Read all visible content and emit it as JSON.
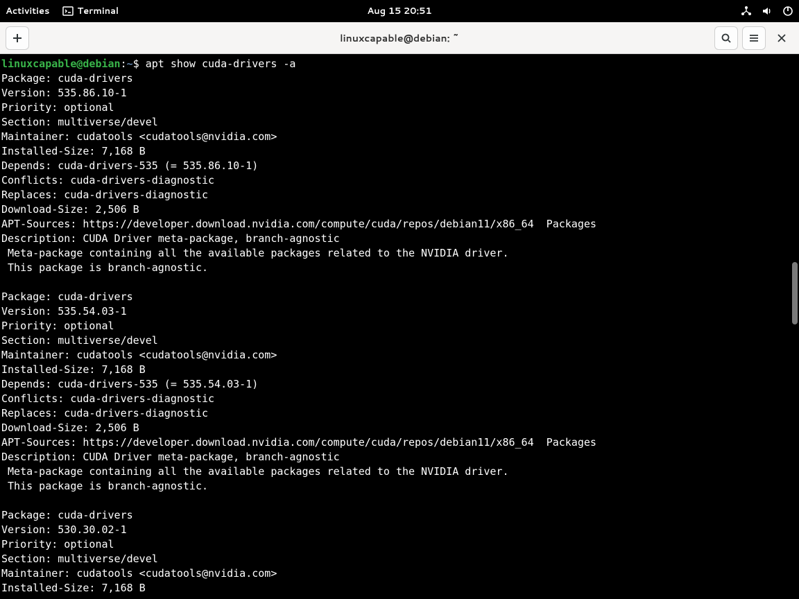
{
  "topbar": {
    "activities": "Activities",
    "app_name": "Terminal",
    "clock": "Aug 15  20:51"
  },
  "window": {
    "title": "linuxcapable@debian: ~"
  },
  "prompt": {
    "user_host": "linuxcapable@debian",
    "colon": ":",
    "cwd": "~",
    "dollar": "$",
    "command": " apt show cuda-drivers -a"
  },
  "packages": [
    {
      "Package": "Package: cuda-drivers",
      "Version": "Version: 535.86.10-1",
      "Priority": "Priority: optional",
      "Section": "Section: multiverse/devel",
      "Maintainer": "Maintainer: cudatools <cudatools@nvidia.com>",
      "Installed": "Installed-Size: 7,168 B",
      "Depends": "Depends: cuda-drivers-535 (= 535.86.10-1)",
      "Conflicts": "Conflicts: cuda-drivers-diagnostic",
      "Replaces": "Replaces: cuda-drivers-diagnostic",
      "Download": "Download-Size: 2,506 B",
      "Sources": "APT-Sources: https://developer.download.nvidia.com/compute/cuda/repos/debian11/x86_64  Packages",
      "Desc": "Description: CUDA Driver meta-package, branch-agnostic",
      "Desc2": " Meta-package containing all the available packages related to the NVIDIA driver.",
      "Desc3": " This package is branch-agnostic."
    },
    {
      "Package": "Package: cuda-drivers",
      "Version": "Version: 535.54.03-1",
      "Priority": "Priority: optional",
      "Section": "Section: multiverse/devel",
      "Maintainer": "Maintainer: cudatools <cudatools@nvidia.com>",
      "Installed": "Installed-Size: 7,168 B",
      "Depends": "Depends: cuda-drivers-535 (= 535.54.03-1)",
      "Conflicts": "Conflicts: cuda-drivers-diagnostic",
      "Replaces": "Replaces: cuda-drivers-diagnostic",
      "Download": "Download-Size: 2,506 B",
      "Sources": "APT-Sources: https://developer.download.nvidia.com/compute/cuda/repos/debian11/x86_64  Packages",
      "Desc": "Description: CUDA Driver meta-package, branch-agnostic",
      "Desc2": " Meta-package containing all the available packages related to the NVIDIA driver.",
      "Desc3": " This package is branch-agnostic."
    },
    {
      "Package": "Package: cuda-drivers",
      "Version": "Version: 530.30.02-1",
      "Priority": "Priority: optional",
      "Section": "Section: multiverse/devel",
      "Maintainer": "Maintainer: cudatools <cudatools@nvidia.com>",
      "Installed": "Installed-Size: 7,168 B"
    }
  ]
}
